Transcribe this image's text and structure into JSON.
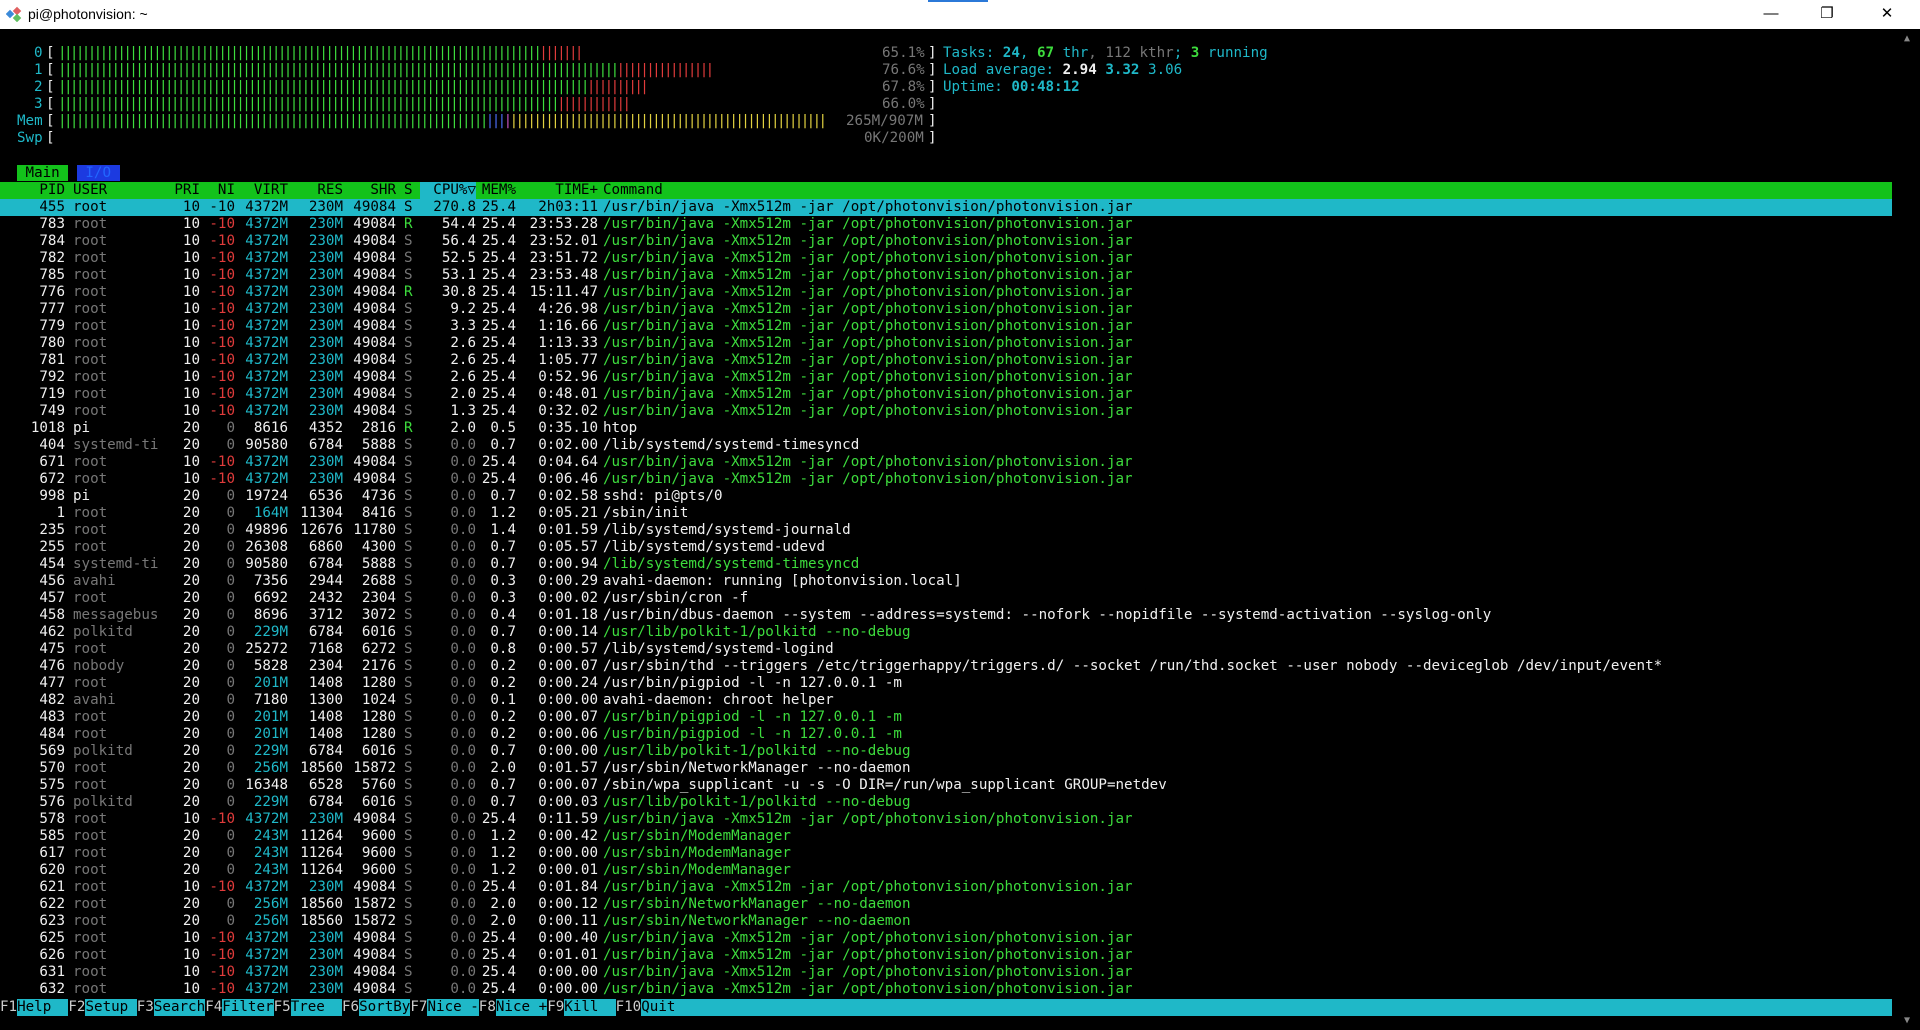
{
  "window": {
    "title": "pi@photonvision: ~",
    "minimize": "—",
    "maximize": "❐",
    "close": "✕"
  },
  "meters": {
    "cpu": [
      {
        "label": "0",
        "pct": "65.1%",
        "frac_green": 0.56,
        "frac_red": 0.046
      },
      {
        "label": "1",
        "pct": "76.6%",
        "frac_green": 0.65,
        "frac_red": 0.11
      },
      {
        "label": "2",
        "pct": "67.8%",
        "frac_green": 0.61,
        "frac_red": 0.07
      },
      {
        "label": "3",
        "pct": "66.0%",
        "frac_green": 0.58,
        "frac_red": 0.08
      }
    ],
    "mem": {
      "label": "Mem",
      "value": "265M/907M"
    },
    "swp": {
      "label": "Swp",
      "value": "0K/200M"
    }
  },
  "stats": {
    "tasks_label": "Tasks: ",
    "tasks": "24",
    "sep1": ", ",
    "thr": "67",
    "thr_label": " thr",
    "sep2": ", ",
    "kthr": "112 kthr",
    "sep3": "; ",
    "running": "3",
    "running_label": " running",
    "load_label": "Load average: ",
    "load1": "2.94",
    "load5": "3.32",
    "load15": "3.06",
    "uptime_label": "Uptime: ",
    "uptime": "00:48:12"
  },
  "tabs": {
    "main": "Main",
    "io": "I/O"
  },
  "columns": [
    "PID",
    "USER",
    "PRI",
    "NI",
    "VIRT",
    "RES",
    "SHR",
    "S",
    "CPU%▽",
    "MEM%",
    "TIME+",
    "Command"
  ],
  "processes": [
    [
      "455",
      "root",
      "10",
      "-10",
      "4372M",
      "230M",
      "49084",
      "S",
      "270.8",
      "25.4",
      "2h03:11",
      "/usr/bin/java -Xmx512m -jar /opt/photonvision/photonvision.jar"
    ],
    [
      "783",
      "root",
      "10",
      "-10",
      "4372M",
      "230M",
      "49084",
      "R",
      "54.4",
      "25.4",
      "23:53.28",
      "/usr/bin/java -Xmx512m -jar /opt/photonvision/photonvision.jar"
    ],
    [
      "784",
      "root",
      "10",
      "-10",
      "4372M",
      "230M",
      "49084",
      "S",
      "56.4",
      "25.4",
      "23:52.01",
      "/usr/bin/java -Xmx512m -jar /opt/photonvision/photonvision.jar"
    ],
    [
      "782",
      "root",
      "10",
      "-10",
      "4372M",
      "230M",
      "49084",
      "S",
      "52.5",
      "25.4",
      "23:51.72",
      "/usr/bin/java -Xmx512m -jar /opt/photonvision/photonvision.jar"
    ],
    [
      "785",
      "root",
      "10",
      "-10",
      "4372M",
      "230M",
      "49084",
      "S",
      "53.1",
      "25.4",
      "23:53.48",
      "/usr/bin/java -Xmx512m -jar /opt/photonvision/photonvision.jar"
    ],
    [
      "776",
      "root",
      "10",
      "-10",
      "4372M",
      "230M",
      "49084",
      "R",
      "30.8",
      "25.4",
      "15:11.47",
      "/usr/bin/java -Xmx512m -jar /opt/photonvision/photonvision.jar"
    ],
    [
      "777",
      "root",
      "10",
      "-10",
      "4372M",
      "230M",
      "49084",
      "S",
      "9.2",
      "25.4",
      "4:26.98",
      "/usr/bin/java -Xmx512m -jar /opt/photonvision/photonvision.jar"
    ],
    [
      "779",
      "root",
      "10",
      "-10",
      "4372M",
      "230M",
      "49084",
      "S",
      "3.3",
      "25.4",
      "1:16.66",
      "/usr/bin/java -Xmx512m -jar /opt/photonvision/photonvision.jar"
    ],
    [
      "780",
      "root",
      "10",
      "-10",
      "4372M",
      "230M",
      "49084",
      "S",
      "2.6",
      "25.4",
      "1:13.33",
      "/usr/bin/java -Xmx512m -jar /opt/photonvision/photonvision.jar"
    ],
    [
      "781",
      "root",
      "10",
      "-10",
      "4372M",
      "230M",
      "49084",
      "S",
      "2.6",
      "25.4",
      "1:05.77",
      "/usr/bin/java -Xmx512m -jar /opt/photonvision/photonvision.jar"
    ],
    [
      "792",
      "root",
      "10",
      "-10",
      "4372M",
      "230M",
      "49084",
      "S",
      "2.6",
      "25.4",
      "0:52.96",
      "/usr/bin/java -Xmx512m -jar /opt/photonvision/photonvision.jar"
    ],
    [
      "719",
      "root",
      "10",
      "-10",
      "4372M",
      "230M",
      "49084",
      "S",
      "2.0",
      "25.4",
      "0:48.01",
      "/usr/bin/java -Xmx512m -jar /opt/photonvision/photonvision.jar"
    ],
    [
      "749",
      "root",
      "10",
      "-10",
      "4372M",
      "230M",
      "49084",
      "S",
      "1.3",
      "25.4",
      "0:32.02",
      "/usr/bin/java -Xmx512m -jar /opt/photonvision/photonvision.jar"
    ],
    [
      "1018",
      "pi",
      "20",
      "0",
      "8616",
      "4352",
      "2816",
      "R",
      "2.0",
      "0.5",
      "0:35.10",
      "htop"
    ],
    [
      "404",
      "systemd-ti",
      "20",
      "0",
      "90580",
      "6784",
      "5888",
      "S",
      "0.0",
      "0.7",
      "0:02.00",
      "/lib/systemd/systemd-timesyncd"
    ],
    [
      "671",
      "root",
      "10",
      "-10",
      "4372M",
      "230M",
      "49084",
      "S",
      "0.0",
      "25.4",
      "0:04.64",
      "/usr/bin/java -Xmx512m -jar /opt/photonvision/photonvision.jar"
    ],
    [
      "672",
      "root",
      "10",
      "-10",
      "4372M",
      "230M",
      "49084",
      "S",
      "0.0",
      "25.4",
      "0:06.46",
      "/usr/bin/java -Xmx512m -jar /opt/photonvision/photonvision.jar"
    ],
    [
      "998",
      "pi",
      "20",
      "0",
      "19724",
      "6536",
      "4736",
      "S",
      "0.0",
      "0.7",
      "0:02.58",
      "sshd: pi@pts/0"
    ],
    [
      "1",
      "root",
      "20",
      "0",
      "164M",
      "11304",
      "8416",
      "S",
      "0.0",
      "1.2",
      "0:05.21",
      "/sbin/init"
    ],
    [
      "235",
      "root",
      "20",
      "0",
      "49896",
      "12676",
      "11780",
      "S",
      "0.0",
      "1.4",
      "0:01.59",
      "/lib/systemd/systemd-journald"
    ],
    [
      "255",
      "root",
      "20",
      "0",
      "26308",
      "6860",
      "4300",
      "S",
      "0.0",
      "0.7",
      "0:05.57",
      "/lib/systemd/systemd-udevd"
    ],
    [
      "454",
      "systemd-ti",
      "20",
      "0",
      "90580",
      "6784",
      "5888",
      "S",
      "0.0",
      "0.7",
      "0:00.94",
      "/lib/systemd/systemd-timesyncd"
    ],
    [
      "456",
      "avahi",
      "20",
      "0",
      "7356",
      "2944",
      "2688",
      "S",
      "0.0",
      "0.3",
      "0:00.29",
      "avahi-daemon: running [photonvision.local]"
    ],
    [
      "457",
      "root",
      "20",
      "0",
      "6692",
      "2432",
      "2304",
      "S",
      "0.0",
      "0.3",
      "0:00.02",
      "/usr/sbin/cron -f"
    ],
    [
      "458",
      "messagebus",
      "20",
      "0",
      "8696",
      "3712",
      "3072",
      "S",
      "0.0",
      "0.4",
      "0:01.18",
      "/usr/bin/dbus-daemon --system --address=systemd: --nofork --nopidfile --systemd-activation --syslog-only"
    ],
    [
      "462",
      "polkitd",
      "20",
      "0",
      "229M",
      "6784",
      "6016",
      "S",
      "0.0",
      "0.7",
      "0:00.14",
      "/usr/lib/polkit-1/polkitd --no-debug"
    ],
    [
      "475",
      "root",
      "20",
      "0",
      "25272",
      "7168",
      "6272",
      "S",
      "0.0",
      "0.8",
      "0:00.57",
      "/lib/systemd/systemd-logind"
    ],
    [
      "476",
      "nobody",
      "20",
      "0",
      "5828",
      "2304",
      "2176",
      "S",
      "0.0",
      "0.2",
      "0:00.07",
      "/usr/sbin/thd --triggers /etc/triggerhappy/triggers.d/ --socket /run/thd.socket --user nobody --deviceglob /dev/input/event*"
    ],
    [
      "477",
      "root",
      "20",
      "0",
      "201M",
      "1408",
      "1280",
      "S",
      "0.0",
      "0.2",
      "0:00.24",
      "/usr/bin/pigpiod -l -n 127.0.0.1 -m"
    ],
    [
      "482",
      "avahi",
      "20",
      "0",
      "7180",
      "1300",
      "1024",
      "S",
      "0.0",
      "0.1",
      "0:00.00",
      "avahi-daemon: chroot helper"
    ],
    [
      "483",
      "root",
      "20",
      "0",
      "201M",
      "1408",
      "1280",
      "S",
      "0.0",
      "0.2",
      "0:00.07",
      "/usr/bin/pigpiod -l -n 127.0.0.1 -m"
    ],
    [
      "484",
      "root",
      "20",
      "0",
      "201M",
      "1408",
      "1280",
      "S",
      "0.0",
      "0.2",
      "0:00.06",
      "/usr/bin/pigpiod -l -n 127.0.0.1 -m"
    ],
    [
      "569",
      "polkitd",
      "20",
      "0",
      "229M",
      "6784",
      "6016",
      "S",
      "0.0",
      "0.7",
      "0:00.00",
      "/usr/lib/polkit-1/polkitd --no-debug"
    ],
    [
      "570",
      "root",
      "20",
      "0",
      "256M",
      "18560",
      "15872",
      "S",
      "0.0",
      "2.0",
      "0:01.57",
      "/usr/sbin/NetworkManager --no-daemon"
    ],
    [
      "575",
      "root",
      "20",
      "0",
      "16348",
      "6528",
      "5760",
      "S",
      "0.0",
      "0.7",
      "0:00.07",
      "/sbin/wpa_supplicant -u -s -O DIR=/run/wpa_supplicant GROUP=netdev"
    ],
    [
      "576",
      "polkitd",
      "20",
      "0",
      "229M",
      "6784",
      "6016",
      "S",
      "0.0",
      "0.7",
      "0:00.03",
      "/usr/lib/polkit-1/polkitd --no-debug"
    ],
    [
      "578",
      "root",
      "10",
      "-10",
      "4372M",
      "230M",
      "49084",
      "S",
      "0.0",
      "25.4",
      "0:11.59",
      "/usr/bin/java -Xmx512m -jar /opt/photonvision/photonvision.jar"
    ],
    [
      "585",
      "root",
      "20",
      "0",
      "243M",
      "11264",
      "9600",
      "S",
      "0.0",
      "1.2",
      "0:00.42",
      "/usr/sbin/ModemManager"
    ],
    [
      "617",
      "root",
      "20",
      "0",
      "243M",
      "11264",
      "9600",
      "S",
      "0.0",
      "1.2",
      "0:00.00",
      "/usr/sbin/ModemManager"
    ],
    [
      "620",
      "root",
      "20",
      "0",
      "243M",
      "11264",
      "9600",
      "S",
      "0.0",
      "1.2",
      "0:00.01",
      "/usr/sbin/ModemManager"
    ],
    [
      "621",
      "root",
      "10",
      "-10",
      "4372M",
      "230M",
      "49084",
      "S",
      "0.0",
      "25.4",
      "0:01.84",
      "/usr/bin/java -Xmx512m -jar /opt/photonvision/photonvision.jar"
    ],
    [
      "622",
      "root",
      "20",
      "0",
      "256M",
      "18560",
      "15872",
      "S",
      "0.0",
      "2.0",
      "0:00.12",
      "/usr/sbin/NetworkManager --no-daemon"
    ],
    [
      "623",
      "root",
      "20",
      "0",
      "256M",
      "18560",
      "15872",
      "S",
      "0.0",
      "2.0",
      "0:00.11",
      "/usr/sbin/NetworkManager --no-daemon"
    ],
    [
      "625",
      "root",
      "10",
      "-10",
      "4372M",
      "230M",
      "49084",
      "S",
      "0.0",
      "25.4",
      "0:00.40",
      "/usr/bin/java -Xmx512m -jar /opt/photonvision/photonvision.jar"
    ],
    [
      "626",
      "root",
      "10",
      "-10",
      "4372M",
      "230M",
      "49084",
      "S",
      "0.0",
      "25.4",
      "0:01.01",
      "/usr/bin/java -Xmx512m -jar /opt/photonvision/photonvision.jar"
    ],
    [
      "631",
      "root",
      "10",
      "-10",
      "4372M",
      "230M",
      "49084",
      "S",
      "0.0",
      "25.4",
      "0:00.00",
      "/usr/bin/java -Xmx512m -jar /opt/photonvision/photonvision.jar"
    ],
    [
      "632",
      "root",
      "10",
      "-10",
      "4372M",
      "230M",
      "49084",
      "S",
      "0.0",
      "25.4",
      "0:00.00",
      "/usr/bin/java -Xmx512m -jar /opt/photonvision/photonvision.jar"
    ]
  ],
  "thread_rows": [
    1,
    2,
    3,
    4,
    5,
    6,
    7,
    8,
    9,
    10,
    11,
    12,
    15,
    16,
    21,
    25,
    30,
    31,
    32,
    35,
    36,
    37,
    38,
    39,
    40,
    41,
    42,
    43,
    44,
    45,
    46
  ],
  "footer": [
    {
      "key": "F1",
      "label": "Help  "
    },
    {
      "key": "F2",
      "label": "Setup "
    },
    {
      "key": "F3",
      "label": "Search"
    },
    {
      "key": "F4",
      "label": "Filter"
    },
    {
      "key": "F5",
      "label": "Tree  "
    },
    {
      "key": "F6",
      "label": "SortBy"
    },
    {
      "key": "F7",
      "label": "Nice -"
    },
    {
      "key": "F8",
      "label": "Nice +"
    },
    {
      "key": "F9",
      "label": "Kill  "
    },
    {
      "key": "F10",
      "label": "Quit  "
    }
  ]
}
